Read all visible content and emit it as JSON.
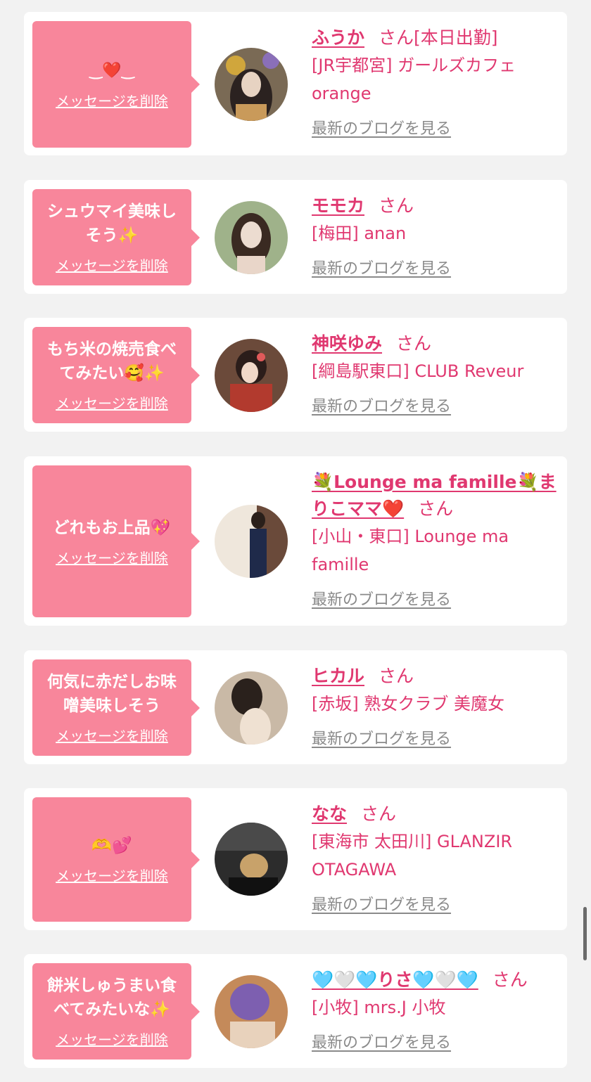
{
  "colors": {
    "accent": "#e03870",
    "bubble": "#f8869b",
    "link_gray": "#8a8a8a",
    "bg": "#f2f2f2"
  },
  "cards": [
    {
      "bubble_text": "‿❤️‿",
      "delete_label": "メッセージを削除",
      "name": "ふうか",
      "san": "さん",
      "shop_inline": "[本日出勤]",
      "shop": "[JR宇都宮] ガールズカフェ orange",
      "blog_label": "最新のブログを見る",
      "avatar_colors": [
        "#7a6a55",
        "#2b2220",
        "#d9c7b5"
      ]
    },
    {
      "bubble_text": "シュウマイ美味しそう✨",
      "delete_label": "メッセージを削除",
      "name": "モモカ",
      "san": "さん",
      "shop": "[梅田] anan",
      "blog_label": "最新のブログを見る",
      "avatar_colors": [
        "#9fb28a",
        "#3a2a22",
        "#e9d6c9"
      ]
    },
    {
      "bubble_text": "もち米の焼売食べてみたい🥰✨",
      "delete_label": "メッセージを削除",
      "name": "神咲ゆみ",
      "san": "さん",
      "shop": "[綱島駅東口] CLUB Reveur",
      "blog_label": "最新のブログを見る",
      "avatar_colors": [
        "#b23a2e",
        "#2b1d1a",
        "#f0d8c8"
      ]
    },
    {
      "bubble_text": "どれもお上品💖",
      "delete_label": "メッセージを削除",
      "name": "💐Lounge ma famille💐まりこママ❤️",
      "san": "さん",
      "shop": "[小山・東口] Lounge ma famille",
      "blog_label": "最新のブログを見る",
      "avatar_colors": [
        "#efe7dc",
        "#1f2a4a",
        "#6a4a3a"
      ]
    },
    {
      "bubble_text": "何気に赤だしお味噌美味しそう",
      "delete_label": "メッセージを削除",
      "name": "ヒカル",
      "san": "さん",
      "shop": "[赤坂] 熟女クラブ 美魔女",
      "blog_label": "最新のブログを見る",
      "avatar_colors": [
        "#c9b9a6",
        "#2a211c",
        "#efe1d2"
      ]
    },
    {
      "bubble_text": "🫶💕",
      "delete_label": "メッセージを削除",
      "name": "なな",
      "san": "さん",
      "shop": "[東海市 太田川] GLANZIR OTAGAWA",
      "blog_label": "最新のブログを見る",
      "avatar_colors": [
        "#2c2c2c",
        "#111111",
        "#c8a26a"
      ]
    },
    {
      "bubble_text": "餅米しゅうまい食べてみたいな✨",
      "delete_label": "メッセージを削除",
      "name": "🩵🤍🩵りさ🩵🤍🩵",
      "san": "さん",
      "shop": "[小牧] mrs.J 小牧",
      "blog_label": "最新のブログを見る",
      "avatar_colors": [
        "#7d5fb0",
        "#c48a5a",
        "#e8d2bc"
      ]
    }
  ]
}
